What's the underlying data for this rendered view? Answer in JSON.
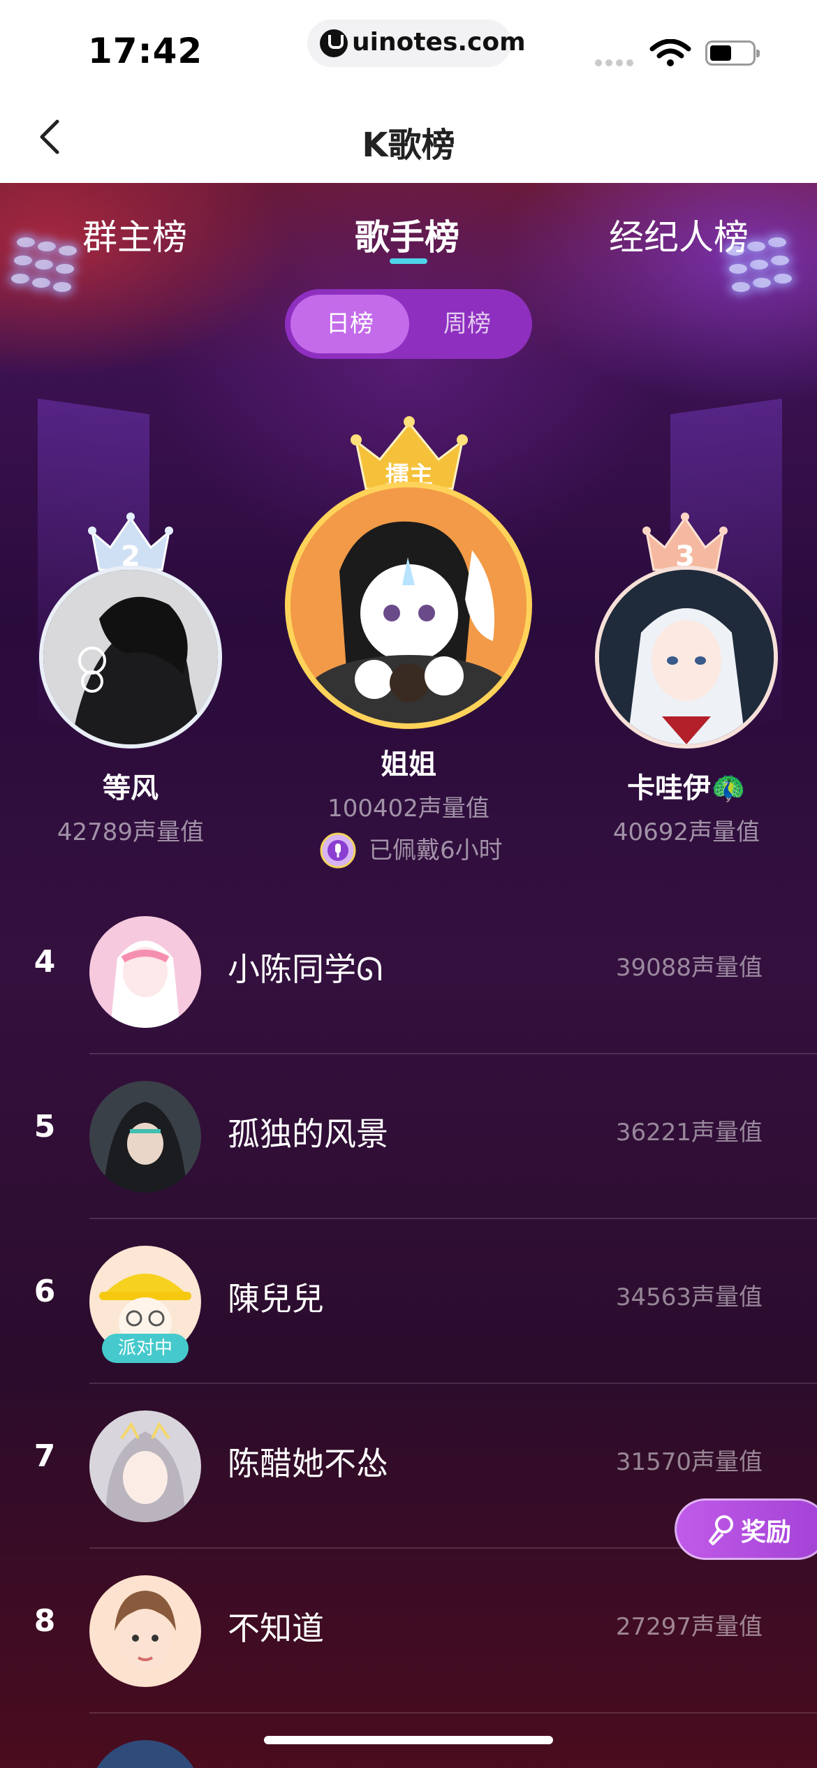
{
  "status_bar": {
    "time": "17:42",
    "url": "uinotes.com"
  },
  "nav": {
    "title": "K歌榜"
  },
  "tabs": [
    {
      "label": "群主榜"
    },
    {
      "label": "歌手榜",
      "active": true
    },
    {
      "label": "经纪人榜"
    }
  ],
  "toggle": {
    "daily": "日榜",
    "weekly": "周榜",
    "selected": "日榜"
  },
  "podium": {
    "first": {
      "crown_label": "擂主",
      "name": "姐姐",
      "score": "100402声量值",
      "badge_text": "已佩戴6小时"
    },
    "second": {
      "crown_label": "2",
      "name": "等风",
      "score": "42789声量值"
    },
    "third": {
      "crown_label": "3",
      "name": "卡哇伊🦚",
      "score": "40692声量值"
    }
  },
  "ranking": [
    {
      "rank": "4",
      "name": "小陈同学ᘏ",
      "score": "39088声量值"
    },
    {
      "rank": "5",
      "name": "孤独的风景",
      "score": "36221声量值"
    },
    {
      "rank": "6",
      "name": "陳兒兒",
      "score": "34563声量值",
      "tag": "派对中"
    },
    {
      "rank": "7",
      "name": "陈醋她不怂",
      "score": "31570声量值"
    },
    {
      "rank": "8",
      "name": "不知道",
      "score": "27297声量值"
    }
  ],
  "reward_button": {
    "label": "奖励"
  },
  "colors": {
    "accent_purple": "#c46bea",
    "tab_underline": "#4fd3e8",
    "party_tag": "#45c9cc"
  }
}
